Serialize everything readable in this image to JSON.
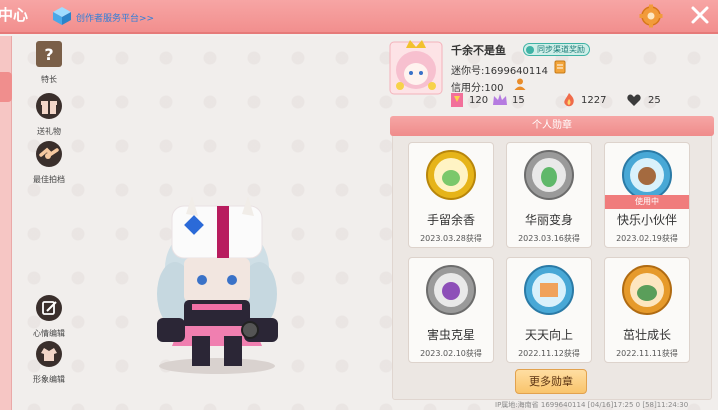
{
  "header": {
    "title_fragment": "中心",
    "platform_link": "创作者服务平台>>",
    "settings_icon": "gear-icon",
    "close_icon": "close-icon"
  },
  "sidebar": {
    "items": [
      {
        "label": "特长",
        "icon": "question-box-icon"
      },
      {
        "label": "送礼物",
        "icon": "gift-icon"
      },
      {
        "label": "最佳拍档",
        "icon": "handshake-icon"
      },
      {
        "label": "心情编辑",
        "icon": "edit-icon"
      },
      {
        "label": "形象编辑",
        "icon": "outfit-icon"
      }
    ]
  },
  "profile": {
    "name": "千余不是鱼",
    "sync_label": "同步渠道奖励",
    "mini_id": "迷你号:1699640114",
    "credit": "信用分:100",
    "stats": [
      "120",
      "15",
      "1227",
      "25"
    ]
  },
  "medals": {
    "header": "个人勋章",
    "in_use_label": "使用中",
    "items": [
      {
        "name": "手留余香",
        "date": "2023.03.28获得",
        "color": "#e6b419"
      },
      {
        "name": "华丽变身",
        "date": "2023.03.16获得",
        "color": "#9a9a9a"
      },
      {
        "name": "快乐小伙伴",
        "date": "2023.02.19获得",
        "color": "#48a8d6"
      },
      {
        "name": "害虫克星",
        "date": "2023.02.10获得",
        "color": "#9a9a9a"
      },
      {
        "name": "天天向上",
        "date": "2022.11.12获得",
        "color": "#48a8d6"
      },
      {
        "name": "茁壮成长",
        "date": "2022.11.11获得",
        "color": "#e69a2b"
      }
    ],
    "more_label": "更多勋章"
  },
  "footer": {
    "text": "IP属地:海南省    1699640114   [04/16]17:25 0 [58]11:24:30"
  }
}
